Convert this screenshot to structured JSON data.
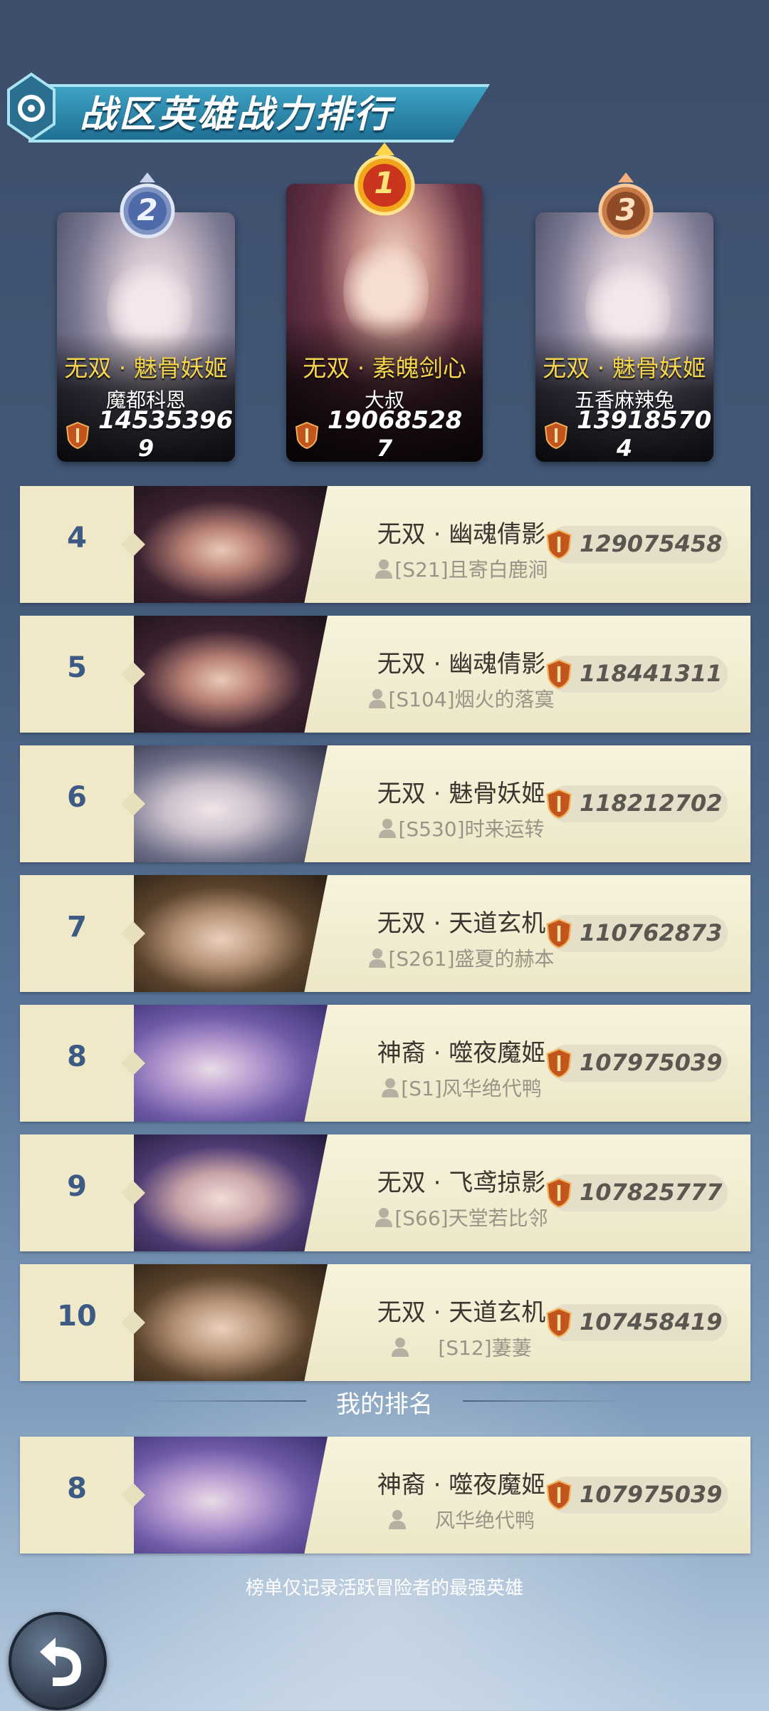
{
  "title": "战区英雄战力排行",
  "podium": [
    {
      "rank_medal": "2",
      "hero": "无双 · 魅骨妖姬",
      "player": "魔都科恩",
      "power": "14535396",
      "rank_num": "9"
    },
    {
      "rank_medal": "1",
      "hero": "无双 · 素魄剑心",
      "player": "大叔",
      "power": "19068528",
      "rank_num": "7"
    },
    {
      "rank_medal": "3",
      "hero": "无双 · 魅骨妖姬",
      "player": "五香麻辣兔",
      "power": "13918570",
      "rank_num": "4"
    }
  ],
  "rows": [
    {
      "rank": "4",
      "hero": "无双 · 幽魂倩影",
      "player": "[S21]且寄白鹿涧",
      "power": "129075458"
    },
    {
      "rank": "5",
      "hero": "无双 · 幽魂倩影",
      "player": "[S104]烟火的落寞",
      "power": "118441311"
    },
    {
      "rank": "6",
      "hero": "无双 · 魅骨妖姬",
      "player": "[S530]时来运转",
      "power": "118212702"
    },
    {
      "rank": "7",
      "hero": "无双 · 天道玄机",
      "player": "[S261]盛夏的赫本",
      "power": "110762873"
    },
    {
      "rank": "8",
      "hero": "神裔 · 噬夜魔姬",
      "player": "[S1]风华绝代鸭",
      "power": "107975039"
    },
    {
      "rank": "9",
      "hero": "无双 · 飞鸢掠影",
      "player": "[S66]天堂若比邻",
      "power": "107825777"
    },
    {
      "rank": "10",
      "hero": "无双 · 天道玄机",
      "player": "[S12]萋萋",
      "power": "107458419"
    }
  ],
  "my_rank_label": "我的排名",
  "my_rank": {
    "rank": "8",
    "hero": "神裔 · 噬夜魔姬",
    "player": "风华绝代鸭",
    "power": "107975039"
  },
  "footnote": "榜单仅记录活跃冒险者的最强英雄",
  "icons": {
    "back": "back-arrow-icon",
    "shield": "shield-sword-icon",
    "user": "user-icon"
  },
  "colors": {
    "gold_text": "#f6d64d",
    "rank_blue": "#3c5a83",
    "row_bg": "#f7f3dc"
  }
}
